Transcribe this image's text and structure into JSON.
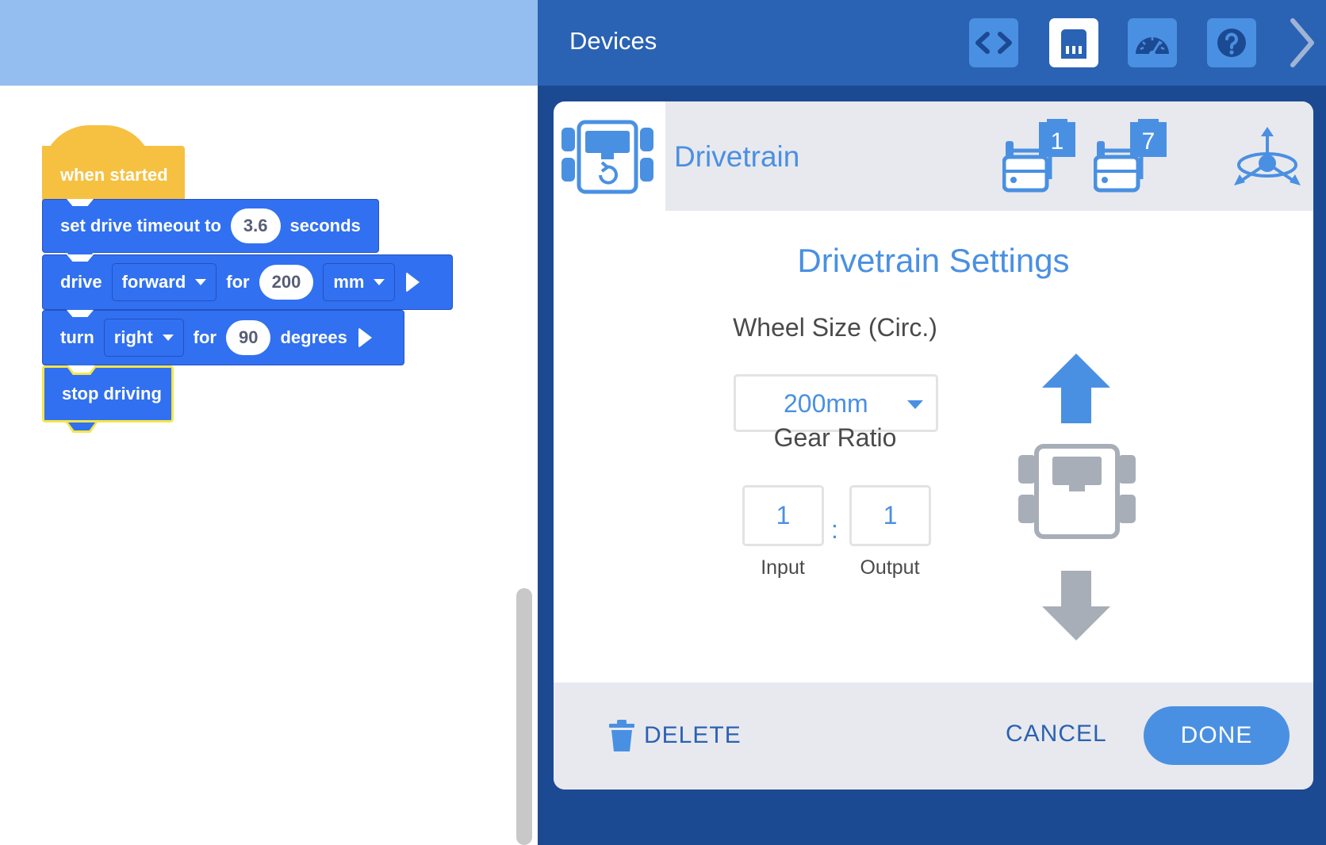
{
  "workspace": {
    "hat_block": {
      "label": "when started"
    },
    "set_timeout_block": {
      "label": "set drive timeout to",
      "value": "3.6",
      "unit": "seconds"
    },
    "drive_block": {
      "label": "drive",
      "direction": "forward",
      "for_label": "for",
      "value": "200",
      "unit": "mm"
    },
    "turn_block": {
      "label": "turn",
      "direction": "right",
      "for_label": "for",
      "value": "90",
      "unit": "degrees"
    },
    "stop_block": {
      "label": "stop driving"
    }
  },
  "devices": {
    "title": "Devices",
    "header_icons": [
      "code-view-icon",
      "devices-icon",
      "dashboard-icon",
      "help-icon",
      "chevron-right-icon"
    ],
    "device": {
      "name": "Drivetrain",
      "ports": [
        "1",
        "7"
      ],
      "icons": [
        "drivetrain-icon",
        "motor-port-icon",
        "gyro-icon"
      ]
    },
    "settings": {
      "title": "Drivetrain Settings",
      "wheel_size_label": "Wheel Size (Circ.)",
      "wheel_size_value": "200mm",
      "gear_ratio_label": "Gear Ratio",
      "gear_input": "1",
      "gear_separator": ":",
      "gear_output": "1",
      "input_label": "Input",
      "output_label": "Output"
    },
    "footer": {
      "delete_label": "DELETE",
      "cancel_label": "CANCEL",
      "done_label": "DONE"
    }
  },
  "colors": {
    "accent_blue": "#4a90e2",
    "block_blue": "#3170f0",
    "hat_yellow": "#f6c041",
    "header_blue": "#2a62b4",
    "panel_dark": "#1c4a92",
    "selection_yellow": "#f7e54b"
  }
}
